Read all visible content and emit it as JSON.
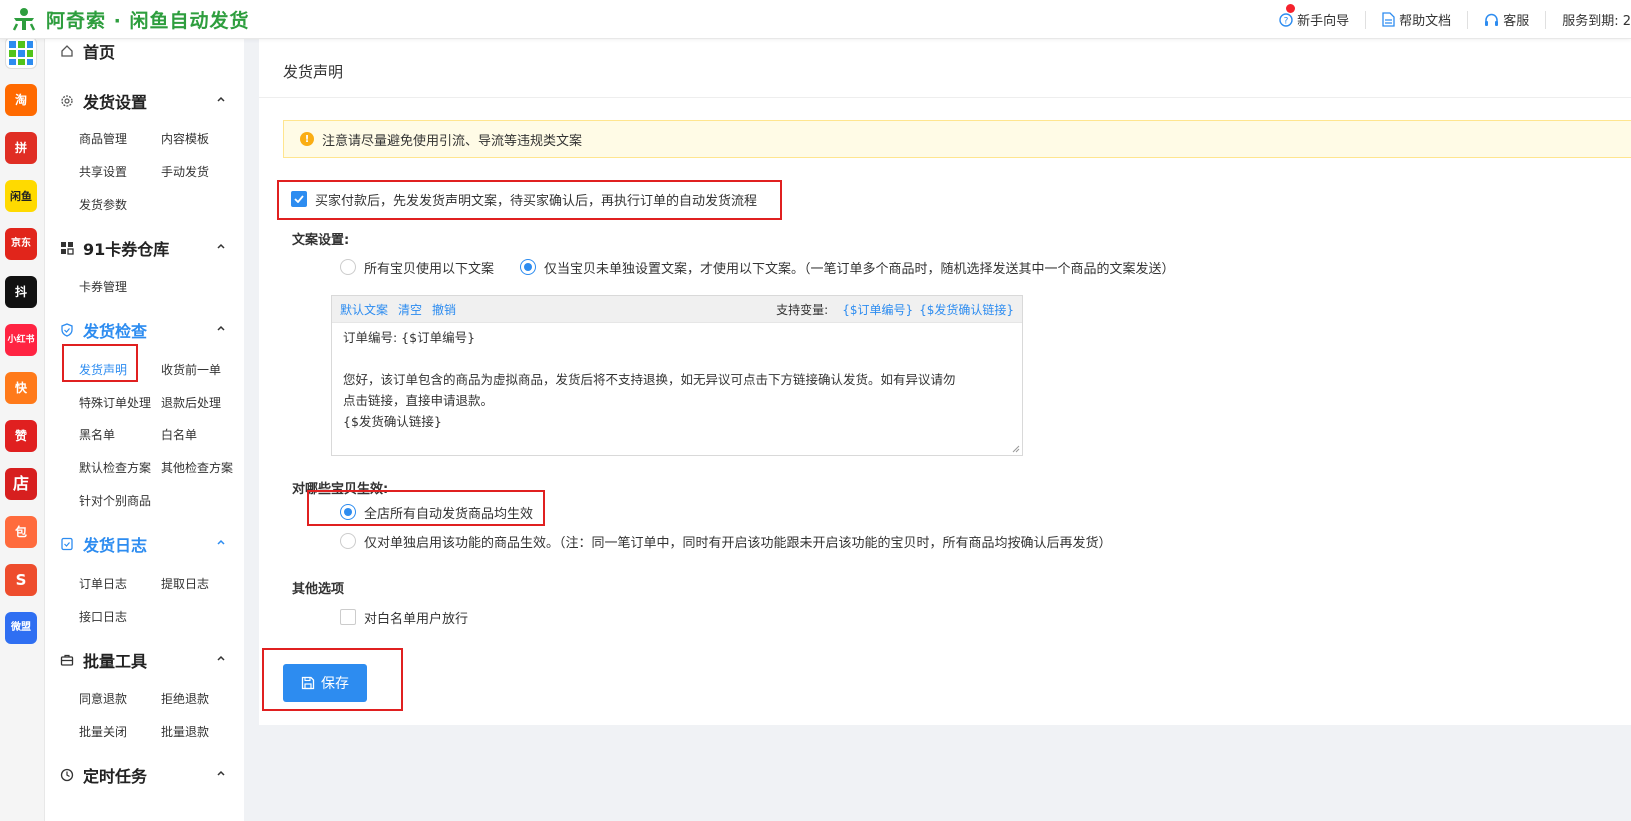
{
  "header": {
    "title": "阿奇索 · 闲鱼自动发货",
    "links": [
      {
        "label": "新手向导"
      },
      {
        "label": "帮助文档"
      },
      {
        "label": "客服"
      },
      {
        "label": "服务到期: 2"
      }
    ]
  },
  "app_bar": {
    "apps": [
      {
        "name": "taobao",
        "label": "淘",
        "color": "#ff6a00"
      },
      {
        "name": "pinduoduo",
        "label": "拼",
        "color": "#e02e24"
      },
      {
        "name": "xianyu",
        "label": "闲鱼",
        "color": "#ffda00"
      },
      {
        "name": "jd",
        "label": "京东",
        "color": "#e1251b"
      },
      {
        "name": "douyin",
        "label": "抖",
        "color": "#111111"
      },
      {
        "name": "xiaohongshu",
        "label": "小红书",
        "color": "#ff2442"
      },
      {
        "name": "kuaishou",
        "label": "快",
        "color": "#ff7a1a"
      },
      {
        "name": "dianzan",
        "label": "赞",
        "color": "#e02020"
      },
      {
        "name": "dian",
        "label": "店",
        "color": "#d71f1f"
      },
      {
        "name": "bag",
        "label": "包",
        "color": "#ff6b3d"
      },
      {
        "name": "shopee",
        "label": "S",
        "color": "#ee4d2d"
      },
      {
        "name": "weimeng",
        "label": "微盟",
        "color": "#2f6ff2"
      }
    ]
  },
  "sidebar": {
    "home": "首页",
    "groups": [
      {
        "title": "发货设置",
        "items": [
          "商品管理",
          "内容模板",
          "共享设置",
          "手动发货",
          "发货参数"
        ]
      },
      {
        "title": "91卡券仓库",
        "items": [
          "卡券管理"
        ]
      },
      {
        "title": "发货检查",
        "items": [
          "发货声明",
          "收货前一单",
          "特殊订单处理",
          "退款后处理",
          "黑名单",
          "白名单",
          "默认检查方案",
          "其他检查方案",
          "针对个别商品"
        ]
      },
      {
        "title": "发货日志",
        "items": [
          "订单日志",
          "提取日志",
          "接口日志"
        ]
      },
      {
        "title": "批量工具",
        "items": [
          "同意退款",
          "拒绝退款",
          "批量关闭",
          "批量退款"
        ]
      },
      {
        "title": "定时任务",
        "items": []
      }
    ]
  },
  "main": {
    "title": "发货声明",
    "notice": "注意请尽量避免使用引流、导流等违规类文案",
    "enable_checkbox": {
      "label": "买家付款后，先发发货声明文案，待买家确认后，再执行订单的自动发货流程",
      "checked": true
    },
    "copy_settings": {
      "label": "文案设置:",
      "options": [
        "所有宝贝使用以下文案",
        "仅当宝贝未单独设置文案，才使用以下文案。（一笔订单多个商品时，随机选择发送其中一个商品的文案发送）"
      ],
      "selected": 1
    },
    "editor": {
      "toolbar": {
        "default": "默认文案",
        "clear": "清空",
        "undo": "撤销",
        "vars_label": "支持变量:",
        "var1": "{$订单编号}",
        "var2": "{$发货确认链接}"
      },
      "lines": [
        "订单编号: {$订单编号}",
        "",
        "您好，该订单包含的商品为虚拟商品，发货后将不支持退换，如无异议可点击下方链接确认发货。如有异议请勿",
        "点击链接，直接申请退款。",
        "{$发货确认链接}"
      ]
    },
    "apply_to": {
      "label": "对哪些宝贝生效:",
      "options": [
        "全店所有自动发货商品均生效",
        "仅对单独启用该功能的商品生效。（注：同一笔订单中，同时有开启该功能跟未开启该功能的宝贝时，所有商品均按确认后再发货）"
      ],
      "selected": 0
    },
    "other": {
      "label": "其他选项",
      "whitelist": {
        "label": "对白名单用户放行",
        "checked": false
      }
    },
    "save_label": "保存"
  },
  "colors": {
    "accent": "#2d8cf0",
    "brand": "#2e9e3e",
    "highlight_box": "#e02020",
    "notice_bg": "#fffbe6"
  }
}
